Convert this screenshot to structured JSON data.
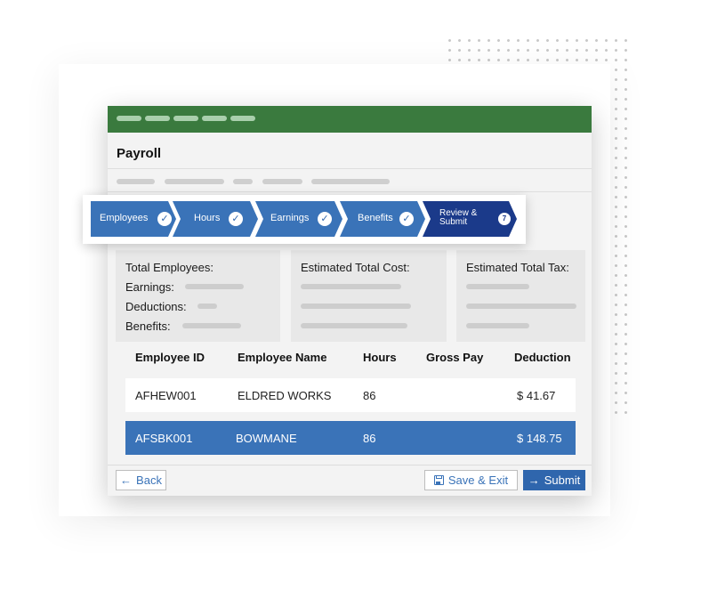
{
  "window": {
    "title": "Payroll"
  },
  "stepper": {
    "steps": [
      {
        "label": "Employees",
        "status": "complete",
        "icon": "check-icon"
      },
      {
        "label": "Hours",
        "status": "complete",
        "icon": "check-icon"
      },
      {
        "label": "Earnings",
        "status": "complete",
        "icon": "check-icon"
      },
      {
        "label": "Benefits",
        "status": "complete",
        "icon": "check-icon"
      },
      {
        "label": "Review & Submit",
        "status": "active",
        "badge": "7"
      }
    ],
    "check_glyph": "✓"
  },
  "summary": {
    "employees": {
      "title": "Total Employees:",
      "earnings_label": "Earnings:",
      "deductions_label": "Deductions:",
      "benefits_label": "Benefits:"
    },
    "cost": {
      "title": "Estimated Total Cost:"
    },
    "tax": {
      "title": "Estimated Total Tax:"
    }
  },
  "table": {
    "columns": [
      "Employee ID",
      "Employee Name",
      "Hours",
      "Gross Pay",
      "Deduction"
    ],
    "rows": [
      {
        "employee_id": "AFHEW001",
        "employee_name": "ELDRED WORKS",
        "hours": "86",
        "gross_pay": "",
        "deduction": "$ 41.67",
        "selected": false
      },
      {
        "employee_id": "AFSBK001",
        "employee_name": "BOWMANE",
        "hours": "86",
        "gross_pay": "",
        "deduction": "$ 148.75",
        "selected": true
      }
    ]
  },
  "footer": {
    "back_label": "Back",
    "back_icon": "←",
    "save_label": "Save & Exit",
    "save_icon": "floppy-disk-icon",
    "submit_label": "Submit",
    "submit_icon": "→"
  },
  "colors": {
    "titlebar": "#3a7a3e",
    "step": "#3a73b8",
    "step_active": "#1b3a8a",
    "selected_row": "#3a73b8",
    "primary_button": "#2f66ad"
  }
}
